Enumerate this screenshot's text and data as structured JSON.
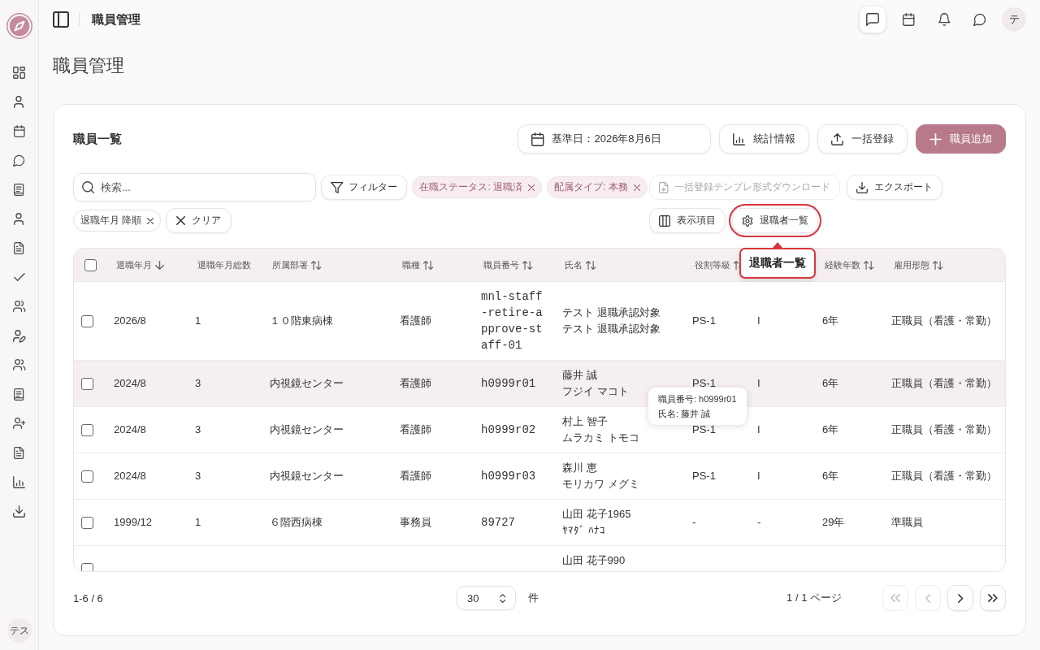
{
  "sidebar": {
    "avatar": "テス"
  },
  "header": {
    "title": "職員管理",
    "actions": [
      {
        "selected": true
      },
      {
        "selected": false
      },
      {
        "selected": false
      },
      {
        "selected": false
      }
    ],
    "avatar": "テ"
  },
  "page_title": "職員管理",
  "staff_list": {
    "title": "職員一覧",
    "base_date": "基準日：2026年8月6日",
    "actions": [
      {
        "label": "統計情報",
        "kind": "stats"
      },
      {
        "label": "一括登録",
        "kind": "upload"
      },
      {
        "label": "職員追加",
        "kind": "add"
      }
    ],
    "search": {
      "placeholder": "検索..."
    },
    "filter_button": "フィルター",
    "chips": [
      {
        "label": "在職ステータス: 退職済",
        "kind": "filter"
      },
      {
        "label": "配属タイプ: 本務",
        "kind": "filter"
      },
      {
        "label": "退職年月 降順",
        "kind": "sort"
      }
    ],
    "clear_button": "クリア",
    "tools": [
      {
        "label": "一括登録テンプレ形式ダウンロード",
        "kind": "template",
        "disabled": true,
        "highlighted": false
      },
      {
        "label": "エクスポート",
        "kind": "export",
        "disabled": false,
        "highlighted": false
      },
      {
        "label": "表示項目",
        "kind": "columns",
        "disabled": false,
        "highlighted": false
      },
      {
        "label": "退職者一覧",
        "kind": "retired",
        "disabled": false,
        "highlighted": true
      }
    ],
    "callout": "退職者一覧",
    "table": {
      "select_all": {
        "checked": false
      },
      "columns": [
        {
          "label": "退職年月",
          "sortable": true,
          "sorted": true
        },
        {
          "label": "退職年月総数",
          "sortable": false
        },
        {
          "label": "所属部署",
          "sortable": true,
          "sorted": false
        },
        {
          "label": "職種",
          "sortable": true,
          "sorted": false
        },
        {
          "label": "職員番号",
          "sortable": true,
          "sorted": false
        },
        {
          "label": "氏名",
          "sortable": true,
          "sorted": false
        },
        {
          "label": "役割等級",
          "sortable": true,
          "sorted": false
        },
        {
          "label": "経験年数",
          "sortable": true,
          "sorted": false
        },
        {
          "label": "雇用形態",
          "sortable": true,
          "sorted": false
        }
      ],
      "rows": [
        {
          "selected": false,
          "hovered": false,
          "retired_month": "2026/8",
          "count": "1",
          "department": "１０階東病棟",
          "job_type": "看護師",
          "staff_number": "mnl-staff-retire-approve-staff-01",
          "name": "テスト 退職承認対象",
          "name_kana": "テスト 退職承認対象",
          "role_grade": "PS-1",
          "column_8": "I",
          "experience": "6年",
          "employment_type": "正職員（看護・常勤）"
        },
        {
          "selected": false,
          "hovered": true,
          "retired_month": "2024/8",
          "count": "3",
          "department": "内視鏡センター",
          "job_type": "看護師",
          "staff_number": "h0999r01",
          "name": "藤井 誠",
          "name_kana": "フジイ マコト",
          "role_grade": "PS-1",
          "column_8": "I",
          "experience": "6年",
          "employment_type": "正職員（看護・常勤）"
        },
        {
          "selected": false,
          "hovered": false,
          "retired_month": "2024/8",
          "count": "3",
          "department": "内視鏡センター",
          "job_type": "看護師",
          "staff_number": "h0999r02",
          "name": "村上 智子",
          "name_kana": "ムラカミ トモコ",
          "role_grade": "PS-1",
          "column_8": "I",
          "experience": "6年",
          "employment_type": "正職員（看護・常勤）"
        },
        {
          "selected": false,
          "hovered": false,
          "retired_month": "2024/8",
          "count": "3",
          "department": "内視鏡センター",
          "job_type": "看護師",
          "staff_number": "h0999r03",
          "name": "森川 恵",
          "name_kana": "モリカワ メグミ",
          "role_grade": "PS-1",
          "column_8": "I",
          "experience": "6年",
          "employment_type": "正職員（看護・常勤）"
        },
        {
          "selected": false,
          "hovered": false,
          "retired_month": "1999/12",
          "count": "1",
          "department": "６階西病棟",
          "job_type": "事務員",
          "staff_number": "89727",
          "name": "山田 花子1965",
          "name_kana": "ﾔﾏﾀﾞ ﾊﾅｺ",
          "role_grade": "-",
          "column_8": "-",
          "experience": "29年",
          "employment_type": "準職員"
        },
        {
          "selected": false,
          "hovered": false,
          "name": "山田 花子990"
        }
      ],
      "tooltip": [
        "職員番号: h0999r01",
        "氏名: 藤井 誠"
      ]
    },
    "pagination": {
      "range": "1-6 / 6",
      "page_size": "30",
      "unit": "件",
      "page_info": "1 / 1 ページ",
      "buttons": [
        {
          "kind": "first",
          "disabled": true
        },
        {
          "kind": "prev",
          "disabled": true
        },
        {
          "kind": "next",
          "disabled": false
        },
        {
          "kind": "last",
          "disabled": false
        }
      ]
    }
  }
}
